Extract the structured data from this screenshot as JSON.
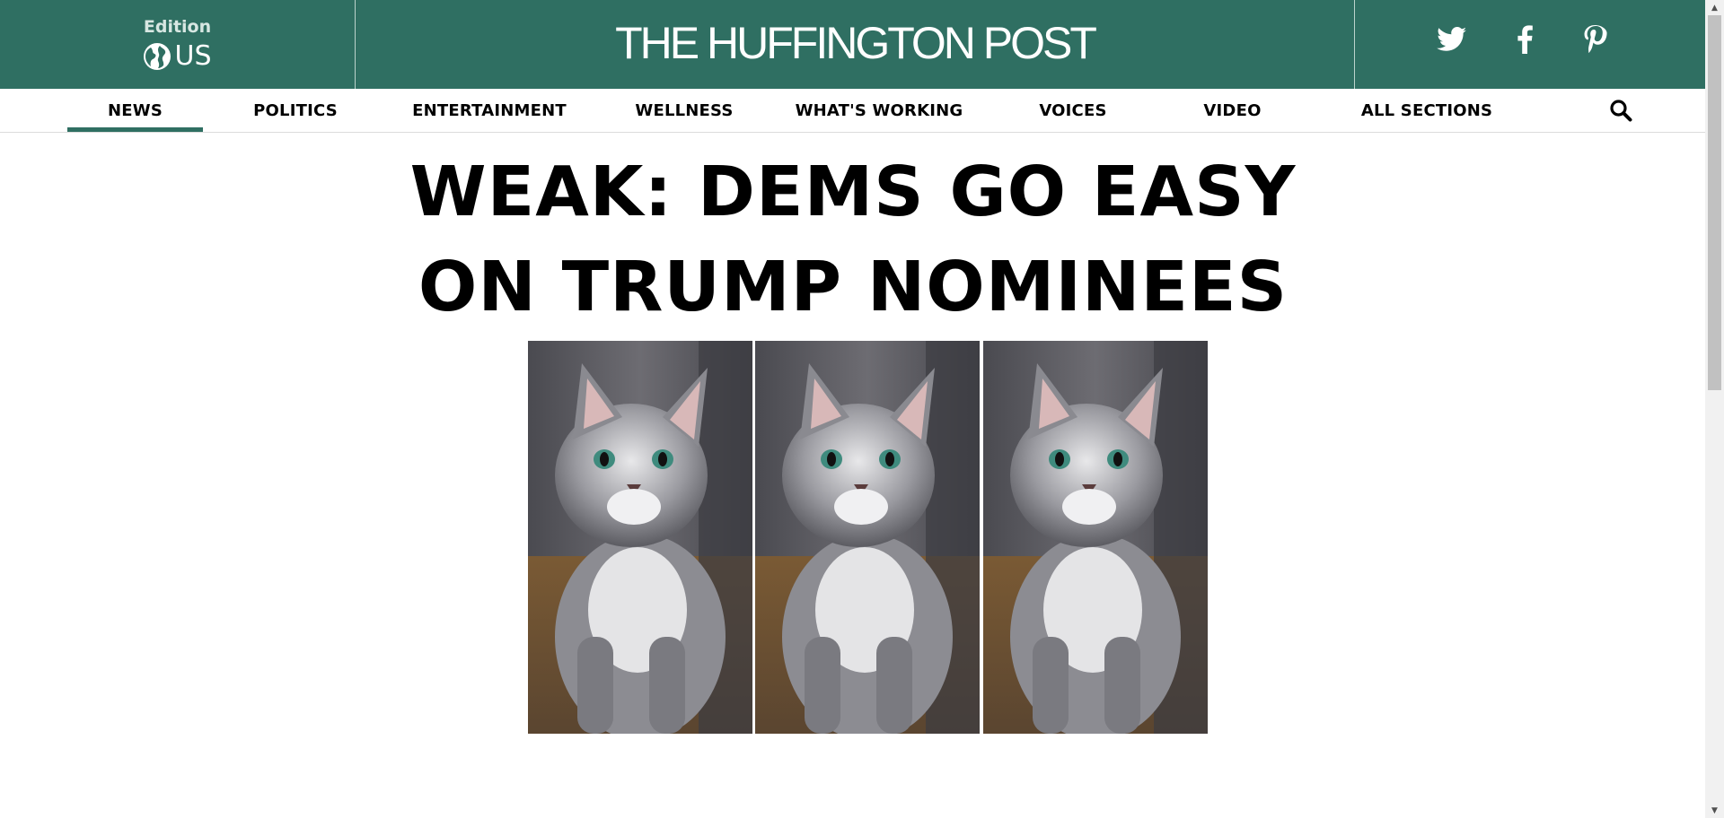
{
  "masthead": {
    "edition_label": "Edition",
    "edition_code": "US",
    "edition_icon": "globe-icon",
    "brand": "THE HUFFINGTON POST",
    "social": [
      {
        "name": "twitter",
        "icon": "twitter-icon"
      },
      {
        "name": "facebook",
        "icon": "facebook-icon"
      },
      {
        "name": "pinterest",
        "icon": "pinterest-icon"
      }
    ]
  },
  "nav": {
    "items": [
      {
        "label": "NEWS",
        "active": true
      },
      {
        "label": "POLITICS",
        "active": false
      },
      {
        "label": "ENTERTAINMENT",
        "active": false
      },
      {
        "label": "WELLNESS",
        "active": false
      },
      {
        "label": "WHAT'S WORKING",
        "active": false
      },
      {
        "label": "VOICES",
        "active": false
      },
      {
        "label": "VIDEO",
        "active": false
      },
      {
        "label": "ALL SECTIONS",
        "active": false
      }
    ],
    "search_icon": "search-icon"
  },
  "headline": {
    "line1": "WEAK: DEMS GO EASY",
    "line2": "ON TRUMP NOMINEES"
  },
  "photos": [
    {
      "subject": "gray tabby kitten"
    },
    {
      "subject": "gray tabby kitten"
    },
    {
      "subject": "gray tabby kitten"
    }
  ],
  "colors": {
    "brand_green": "#2f6f62",
    "text": "#000000",
    "background": "#ffffff"
  }
}
